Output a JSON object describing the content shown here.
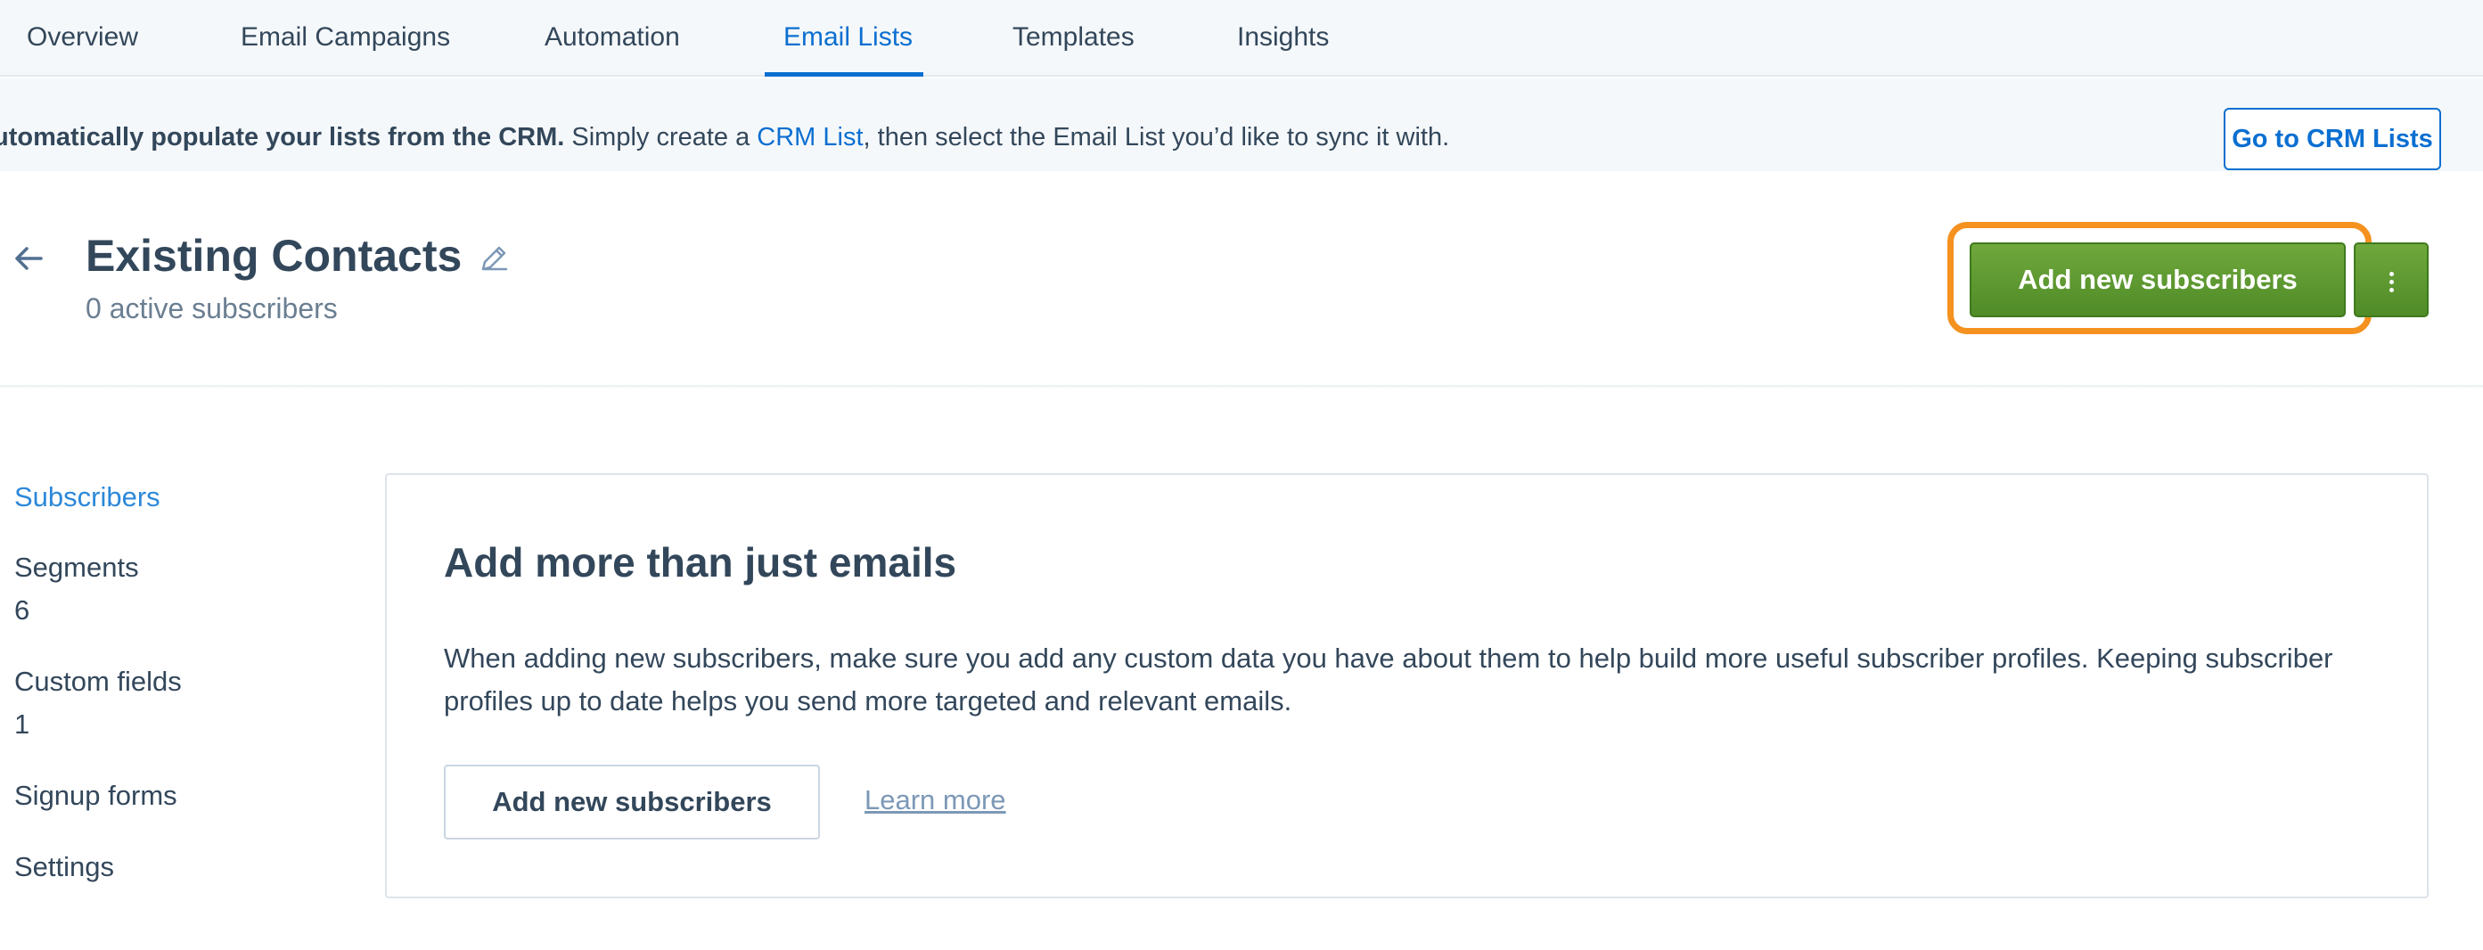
{
  "nav": {
    "tabs": [
      {
        "label": "Overview"
      },
      {
        "label": "Email Campaigns"
      },
      {
        "label": "Automation"
      },
      {
        "label": "Email Lists"
      },
      {
        "label": "Templates"
      },
      {
        "label": "Insights"
      }
    ],
    "active_tab": "Email Lists"
  },
  "banner": {
    "bold_text": "utomatically populate your lists from the CRM.",
    "text_before_link": " Simply create a ",
    "link_text": "CRM List",
    "text_after_link": ", then select the Email List you’d like to sync it with.",
    "button_label": "Go to CRM Lists"
  },
  "header": {
    "title": "Existing Contacts",
    "subtitle": "0 active subscribers",
    "primary_button": "Add new subscribers",
    "back_icon": "arrow-left-icon",
    "edit_icon": "pencil-icon",
    "more_icon": "vertical-ellipsis-icon"
  },
  "sidebar": {
    "items": [
      {
        "label": "Subscribers",
        "count": ""
      },
      {
        "label": "Segments",
        "count": "6"
      },
      {
        "label": "Custom fields",
        "count": "1"
      },
      {
        "label": "Signup forms",
        "count": ""
      },
      {
        "label": "Settings",
        "count": ""
      }
    ],
    "active_item": "Subscribers"
  },
  "card": {
    "title": "Add more than just emails",
    "body": "When adding new subscribers, make sure you add any custom data you have about them to help build more useful subscriber profiles. Keeping subscriber profiles up to date helps you send more targeted and relevant emails.",
    "button_label": "Add new subscribers",
    "link_label": "Learn more"
  },
  "colors": {
    "accent_blue": "#0b6fd1",
    "primary_green": "#5c9a30",
    "highlight_orange": "#f5911f",
    "sidebar_active": "#2c88d9",
    "text": "#33475b"
  }
}
